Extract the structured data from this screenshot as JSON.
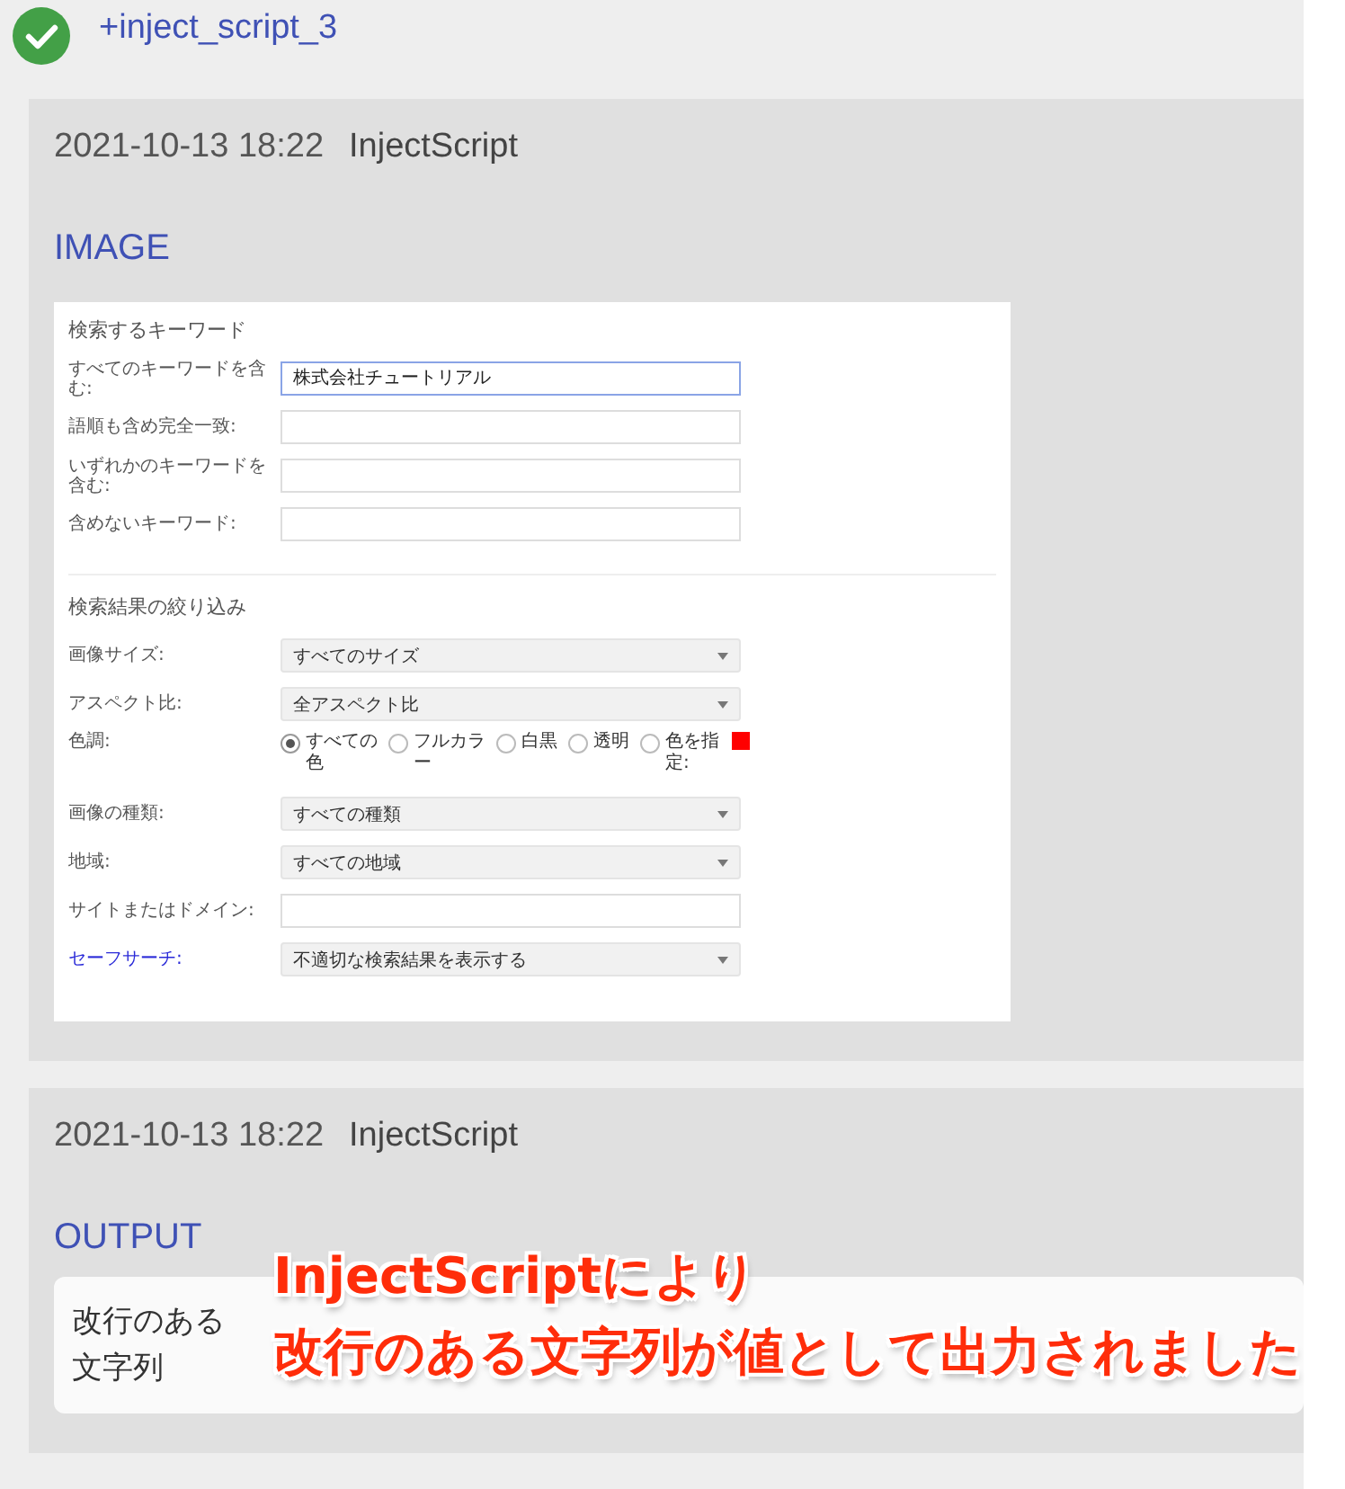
{
  "task": {
    "succeeded": true,
    "name": "+inject_script_3"
  },
  "logs": [
    {
      "time": "2021-10-13 18:22",
      "source": "InjectScript",
      "kind": "image",
      "label": "IMAGE",
      "form": {
        "sections": [
          {
            "title": "検索するキーワード",
            "rows": [
              {
                "kind": "text",
                "label": "すべてのキーワードを含む:",
                "value": "株式会社チュートリアル",
                "focused": true
              },
              {
                "kind": "text",
                "label": "語順も含め完全一致:",
                "focused": false
              },
              {
                "kind": "text",
                "label": "いずれかのキーワードを含む:",
                "focused": false
              },
              {
                "kind": "text",
                "label": "含めないキーワード:",
                "focused": false
              }
            ]
          },
          {
            "title": "検索結果の絞り込み",
            "rows": [
              {
                "kind": "select",
                "label": "画像サイズ:",
                "value": "すべてのサイズ",
                "link": false
              },
              {
                "kind": "select",
                "label": "アスペクト比:",
                "value": "全アスペクト比",
                "link": false
              },
              {
                "kind": "radio",
                "label": "色調:",
                "options": [
                  {
                    "label": "すべての色",
                    "selected": true
                  },
                  {
                    "label": "フルカラー",
                    "selected": false
                  },
                  {
                    "label": "白黒",
                    "selected": false
                  },
                  {
                    "label": "透明",
                    "selected": false
                  },
                  {
                    "label": "色を指定:",
                    "selected": false,
                    "color": "#ff0000"
                  }
                ]
              },
              {
                "kind": "select",
                "label": "画像の種類:",
                "value": "すべての種類",
                "link": false
              },
              {
                "kind": "select",
                "label": "地域:",
                "value": "すべての地域",
                "link": false
              },
              {
                "kind": "text",
                "label": "サイトまたはドメイン:",
                "focused": false
              },
              {
                "kind": "select",
                "label": "セーフサーチ:",
                "value": "不適切な検索結果を表示する",
                "link": true
              }
            ]
          }
        ]
      }
    },
    {
      "time": "2021-10-13 18:22",
      "source": "InjectScript",
      "kind": "output",
      "label": "OUTPUT",
      "output": [
        "改行のある",
        "文字列"
      ],
      "annotation": [
        "InjectScriptにより",
        "改行のある文字列が値として出力されました"
      ]
    }
  ]
}
